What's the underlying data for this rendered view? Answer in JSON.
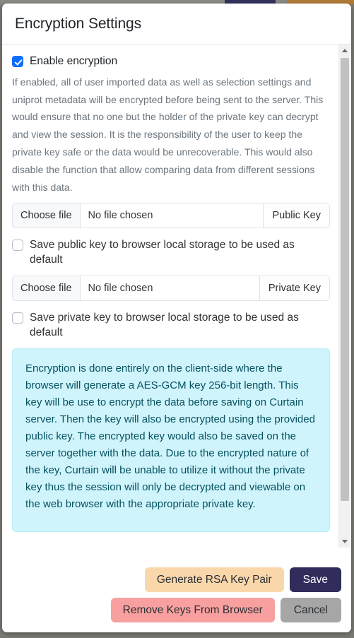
{
  "background": {
    "hidden_button_navy_color": "#32325d",
    "hidden_button_orange_color": "#b07b36"
  },
  "modal": {
    "title": "Encryption Settings",
    "enable": {
      "label": "Enable encryption",
      "checked": true,
      "description": "If enabled, all of user imported data as well as selection settings and uniprot metadata will be encrypted before being sent to the server. This would ensure that no one but the holder of the private key can decrypt and view the session. It is the responsibility of the user to keep the private key safe or the data would be unrecoverable. This would also disable the function that allow comparing data from different sessions with this data."
    },
    "public_key": {
      "choose_button": "Choose file",
      "file_status": "No file chosen",
      "tail_label": "Public Key",
      "save_checkbox_label": "Save public key to browser local storage to be used as default",
      "save_checkbox_checked": false
    },
    "private_key": {
      "choose_button": "Choose file",
      "file_status": "No file chosen",
      "tail_label": "Private Key",
      "save_checkbox_label": "Save private key to browser local storage to be used as default",
      "save_checkbox_checked": false
    },
    "info_alert": {
      "text": "Encryption is done entirely on the client-side where the browser will generate a AES-GCM key 256-bit length. This key will be use to encrypt the data before saving on Curtain server. Then the key will also be encrypted using the provided public key. The encrypted key would also be saved on the server together with the data. Due to the encrypted nature of the key, Curtain will be unable to utilize it without the private key thus the session will only be decrypted and viewable on the web browser with the appropriate private key.",
      "background_color": "#cff4fc",
      "text_color": "#055160"
    },
    "footer": {
      "generate_label": "Generate RSA Key Pair",
      "save_label": "Save",
      "remove_label": "Remove Keys From Browser",
      "cancel_label": "Cancel",
      "generate_color": "#fad7ab",
      "save_color": "#302c5c",
      "remove_color": "#f8a0a0",
      "cancel_color": "#a6a6a6"
    },
    "scrollbar": {
      "up_icon": "caret-up-icon",
      "down_icon": "caret-down-icon"
    }
  }
}
